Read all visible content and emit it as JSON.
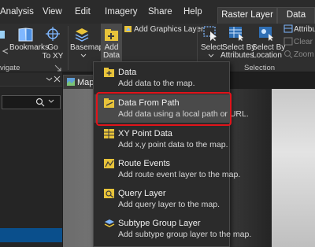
{
  "menubar": {
    "tabs": [
      "Analysis",
      "View",
      "Edit",
      "Imagery",
      "Share",
      "Help"
    ],
    "context_tabs": [
      "Raster Layer",
      "Data"
    ]
  },
  "ribbon": {
    "bookmarks": "Bookmarks",
    "goto_line1": "Go",
    "goto_line2": "To XY",
    "basemap": "Basemap",
    "add_line1": "Add",
    "add_line2": "Data",
    "add_graphics_layer": "Add Graphics Layer",
    "select": "Select",
    "select_by_attr_line1": "Select By",
    "select_by_attr_line2": "Attributes",
    "select_by_loc_line1": "Select By",
    "select_by_loc_line2": "Location",
    "attributes": "Attribu",
    "clear": "Clear",
    "zoom_to": "Zoom T",
    "group_navigate": "vigate",
    "group_selection": "Selection"
  },
  "map_tab": "Map",
  "dropdown": {
    "items": [
      {
        "title": "Data",
        "desc": "Add data to the map."
      },
      {
        "title": "Data From Path",
        "desc": "Add data using a local path or URL."
      },
      {
        "title": "XY Point Data",
        "desc": "Add x,y point data to the map."
      },
      {
        "title": "Route Events",
        "desc": "Add route event layer to the map."
      },
      {
        "title": "Query Layer",
        "desc": "Add query layer to the map."
      },
      {
        "title": "Subtype Group Layer",
        "desc": "Add subtype group layer to the map."
      }
    ]
  },
  "colors": {
    "highlight": "#e0141b",
    "selection_bar": "#0a4f8c",
    "icon_yellow": "#e8c33a",
    "icon_blue": "#3a8be0"
  }
}
